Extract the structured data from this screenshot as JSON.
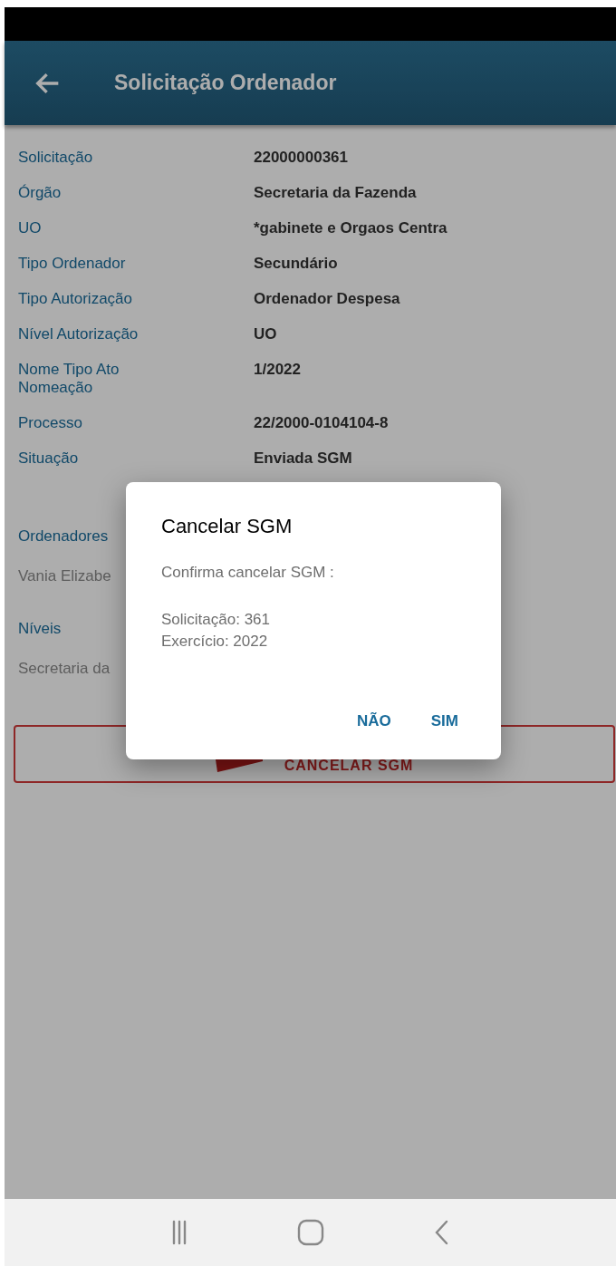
{
  "app_bar": {
    "title": "Solicitação Ordenador"
  },
  "details": [
    {
      "label": "Solicitação",
      "value": "22000000361"
    },
    {
      "label": "Órgão",
      "value": "Secretaria da Fazenda"
    },
    {
      "label": "UO",
      "value": "*gabinete e Orgaos Centra"
    },
    {
      "label": "Tipo Ordenador",
      "value": "Secundário"
    },
    {
      "label": "Tipo Autorização",
      "value": "Ordenador Despesa"
    },
    {
      "label": "Nível Autorização",
      "value": "UO"
    },
    {
      "label": "Nome Tipo Ato Nomeação",
      "value": "1/2022"
    },
    {
      "label": "Processo",
      "value": "22/2000-0104104-8"
    },
    {
      "label": "Situação",
      "value": "Enviada SGM"
    }
  ],
  "sections": [
    {
      "heading": "Ordenadores",
      "items": [
        "Vania Elizabe"
      ]
    },
    {
      "heading": "Níveis",
      "items": [
        "Secretaria da"
      ]
    }
  ],
  "cancel_button": {
    "label": "CANCELAR SGM"
  },
  "dialog": {
    "title": "Cancelar SGM",
    "message": "Confirma cancelar SGM :",
    "details": [
      "Solicitação: 361",
      "Exercício: 2022"
    ],
    "actions": [
      "NÃO",
      "SIM"
    ]
  }
}
